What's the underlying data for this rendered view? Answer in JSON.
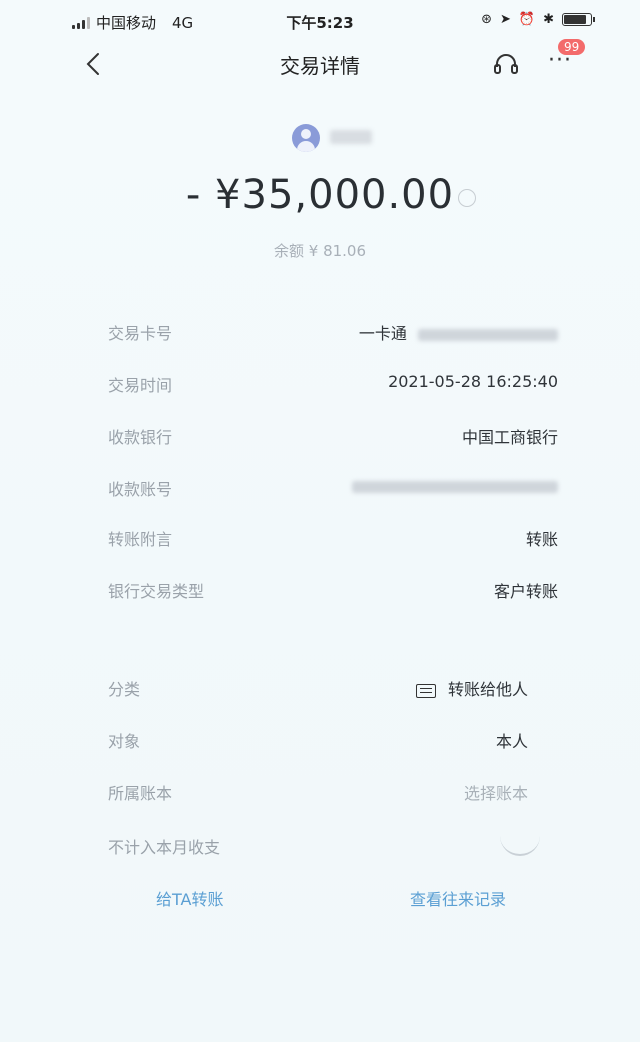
{
  "status_bar": {
    "carrier": "中国移动",
    "network": "4G",
    "time": "下午5:23"
  },
  "nav": {
    "title": "交易详情",
    "badge_count": "99"
  },
  "header": {
    "amount": "- ¥35,000.00",
    "balance": "余额 ¥ 81.06"
  },
  "details": {
    "card_label": "交易卡号",
    "card_value": "一卡通",
    "time_label": "交易时间",
    "time_value": "2021-05-28 16:25:40",
    "bank_label": "收款银行",
    "bank_value": "中国工商银行",
    "account_label": "收款账号",
    "memo_label": "转账附言",
    "memo_value": "转账",
    "type_label": "银行交易类型",
    "type_value": "客户转账"
  },
  "category": {
    "category_label": "分类",
    "category_value": "转账给他人",
    "target_label": "对象",
    "target_value": "本人",
    "ledger_label": "所属账本",
    "ledger_value": "选择账本",
    "exclude_label": "不计入本月收支"
  },
  "actions": {
    "transfer_again": "给TA转账",
    "view_history": "查看往来记录"
  },
  "colors": {
    "background": "#f3f9fb",
    "link": "#5b9fd3",
    "badge": "#f36b6b",
    "avatar": "#8a9bd8"
  }
}
